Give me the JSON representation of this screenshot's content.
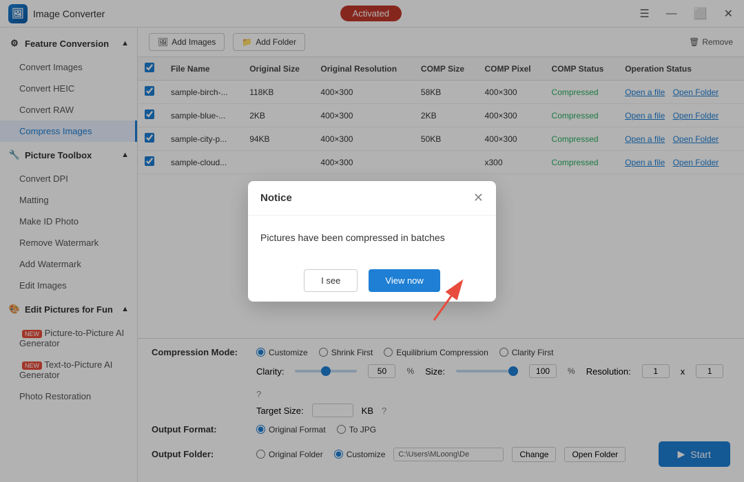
{
  "titleBar": {
    "appName": "Image Converter",
    "activatedLabel": "Activated"
  },
  "sidebar": {
    "sections": [
      {
        "id": "feature-conversion",
        "label": "Feature Conversion",
        "icon": "grid-icon",
        "expanded": true,
        "items": [
          {
            "id": "convert-images",
            "label": "Convert Images",
            "active": false
          },
          {
            "id": "convert-heic",
            "label": "Convert HEIC",
            "active": false
          },
          {
            "id": "convert-raw",
            "label": "Convert RAW",
            "active": false
          },
          {
            "id": "compress-images",
            "label": "Compress Images",
            "active": true
          }
        ]
      },
      {
        "id": "picture-toolbox",
        "label": "Picture Toolbox",
        "icon": "toolbox-icon",
        "expanded": true,
        "items": [
          {
            "id": "convert-dpi",
            "label": "Convert DPI",
            "active": false
          },
          {
            "id": "matting",
            "label": "Matting",
            "active": false
          },
          {
            "id": "make-id-photo",
            "label": "Make ID Photo",
            "active": false
          },
          {
            "id": "remove-watermark",
            "label": "Remove Watermark",
            "active": false
          },
          {
            "id": "add-watermark",
            "label": "Add Watermark",
            "active": false
          },
          {
            "id": "edit-images",
            "label": "Edit Images",
            "active": false
          }
        ]
      },
      {
        "id": "edit-pictures-for-fun",
        "label": "Edit Pictures for Fun",
        "icon": "fun-icon",
        "expanded": true,
        "items": [
          {
            "id": "picture-to-picture",
            "label": "Picture-to-Picture AI Generator",
            "active": false,
            "badge": "NEW"
          },
          {
            "id": "text-to-picture",
            "label": "Text-to-Picture AI Generator",
            "active": false,
            "badge": "NEW"
          },
          {
            "id": "photo-restoration",
            "label": "Photo Restoration",
            "active": false
          }
        ]
      }
    ]
  },
  "toolbar": {
    "addImagesLabel": "Add Images",
    "addFolderLabel": "Add Folder",
    "removeLabel": "Remove"
  },
  "table": {
    "columns": [
      "",
      "File Name",
      "Original Size",
      "Original Resolution",
      "COMP Size",
      "COMP Pixel",
      "COMP Status",
      "Operation Status"
    ],
    "rows": [
      {
        "checked": true,
        "fileName": "sample-birch-...",
        "originalSize": "118KB",
        "originalResolution": "400×300",
        "compSize": "58KB",
        "compPixel": "400×300",
        "compStatus": "Compressed",
        "action1": "Open a file",
        "action2": "Open Folder"
      },
      {
        "checked": true,
        "fileName": "sample-blue-...",
        "originalSize": "2KB",
        "originalResolution": "400×300",
        "compSize": "2KB",
        "compPixel": "400×300",
        "compStatus": "Compressed",
        "action1": "Open a file",
        "action2": "Open Folder"
      },
      {
        "checked": true,
        "fileName": "sample-city-p...",
        "originalSize": "94KB",
        "originalResolution": "400×300",
        "compSize": "50KB",
        "compPixel": "400×300",
        "compStatus": "Compressed",
        "action1": "Open a file",
        "action2": "Open Folder"
      },
      {
        "checked": true,
        "fileName": "sample-cloud...",
        "originalSize": "",
        "originalResolution": "400×300",
        "compSize": "",
        "compPixel": "x300",
        "compStatus": "Compressed",
        "action1": "Open a file",
        "action2": "Open Folder"
      }
    ]
  },
  "settings": {
    "compressionModeLabel": "Compression Mode:",
    "modes": [
      {
        "id": "customize",
        "label": "Customize",
        "selected": true
      },
      {
        "id": "shrink-first",
        "label": "Shrink First",
        "selected": false
      },
      {
        "id": "equilibrium",
        "label": "Equilibrium Compression",
        "selected": false
      },
      {
        "id": "clarity-first",
        "label": "Clarity First",
        "selected": false
      }
    ],
    "clarityLabel": "Clarity:",
    "clarityValue": "50",
    "clarityUnit": "%",
    "sizeLabel": "Size:",
    "sizeValue": "100",
    "sizeUnit": "%",
    "resolutionLabel": "Resolution:",
    "resolutionW": "1",
    "resolutionX": "x",
    "resolutionH": "1",
    "targetSizeLabel": "Target Size:",
    "targetSizeUnit": "KB",
    "outputFormatLabel": "Output Format:",
    "outputFormats": [
      {
        "id": "original-format",
        "label": "Original Format",
        "selected": true
      },
      {
        "id": "to-jpg",
        "label": "To JPG",
        "selected": false
      }
    ],
    "outputFolderLabel": "Output Folder:",
    "folderOptions": [
      {
        "id": "original-folder",
        "label": "Original Folder",
        "selected": false
      },
      {
        "id": "customize-folder",
        "label": "Customize",
        "selected": true
      }
    ],
    "folderPath": "C:\\Users\\MLoong\\De",
    "changeLabel": "Change",
    "openFolderLabel": "Open Folder",
    "startLabel": "Start"
  },
  "dialog": {
    "title": "Notice",
    "message": "Pictures have been compressed in batches",
    "btnISee": "I see",
    "btnViewNow": "View now"
  }
}
